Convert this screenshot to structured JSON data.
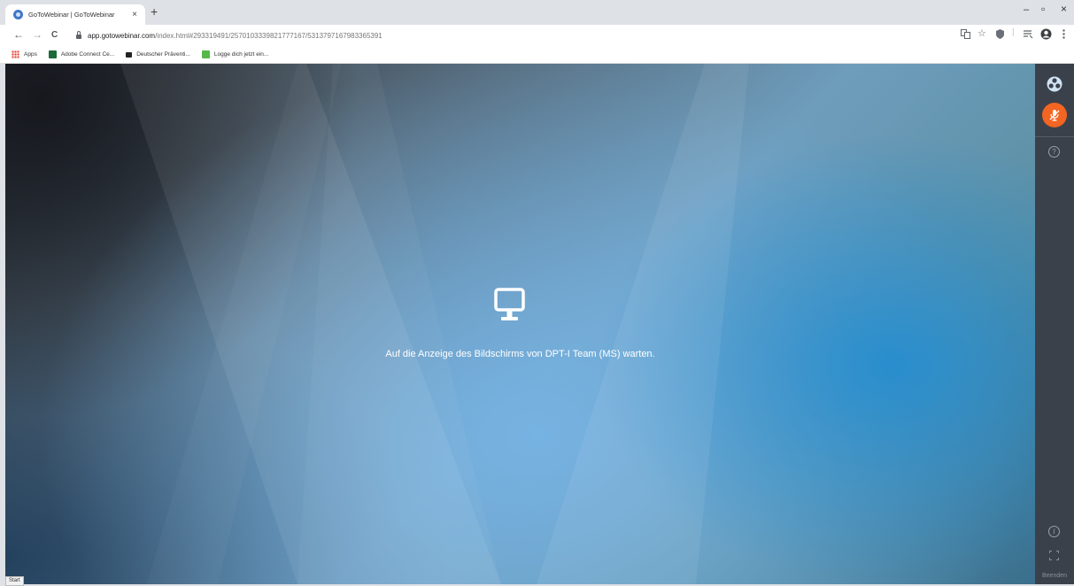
{
  "browser": {
    "tab": {
      "title": "GoToWebinar | GoToWebinar",
      "close_glyph": "×",
      "favicon": "gotowebinar-icon"
    },
    "new_tab_glyph": "+",
    "window_controls": {
      "minimize": "–",
      "restore": "▫",
      "close": "×"
    },
    "nav": {
      "back": "←",
      "forward": "→",
      "reload": "C"
    },
    "address": {
      "host": "app.gotowebinar.com",
      "path": "/index.html#293319491/2570103339821777167/5313797167983365391"
    },
    "toolbar_icons": [
      "translate-icon",
      "star-icon",
      "extension-icon",
      "reading-list-icon",
      "profile-icon",
      "menu-icon"
    ],
    "bookmarks": [
      {
        "label": "Apps",
        "icon": "apps-grid-icon"
      },
      {
        "label": "Adobe Connect Ce...",
        "icon": "adobe-connect-icon"
      },
      {
        "label": "Deutscher Präventi...",
        "icon": "video-camera-icon"
      },
      {
        "label": "Logge dich jetzt ein...",
        "icon": "chart-icon"
      }
    ]
  },
  "webinar": {
    "waiting_message": "Auf die Anzeige des Bildschirms von DPT-I Team (MS) warten.",
    "placeholder_icon": "monitor-icon",
    "side_panel": {
      "end_label": "Beenden",
      "help_glyph": "?",
      "info_glyph": "i"
    },
    "taskbar_label": "Start",
    "colors": {
      "mic_accent": "#f26522",
      "panel_bg": "#3b414b"
    }
  }
}
